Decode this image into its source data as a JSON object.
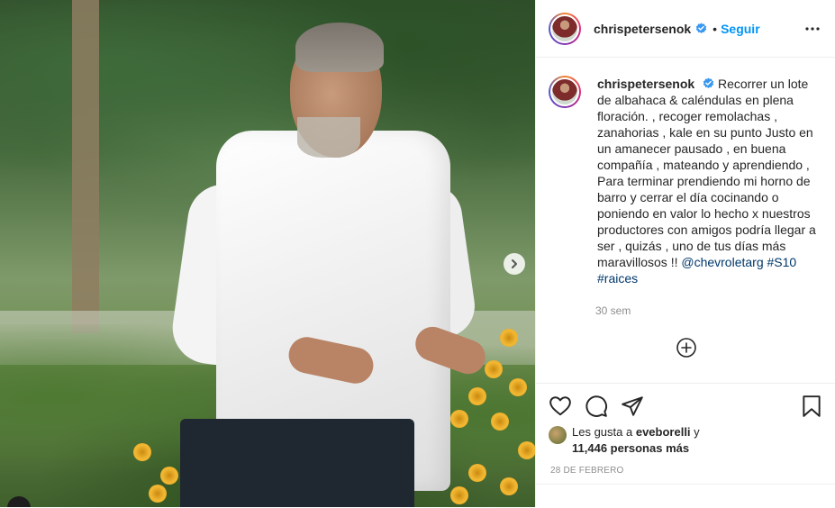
{
  "author": {
    "username": "chrispetersenok",
    "verified": true,
    "follow_label": "Seguir"
  },
  "caption": {
    "text": "Recorrer un lote de albahaca & caléndulas en plena floración. , recoger remolachas , zanahorias , kale en su punto Justo en un amanecer pausado , en buena compañía , mateando y aprendiendo , Para terminar prendiendo mi horno de barro y cerrar el día cocinando o poniendo en valor lo hecho x nuestros productores con amigos podría llegar a ser , quizás , uno de tus días más maravillosos !!",
    "mention": "@chevroletarg",
    "hashtag1": "#S10",
    "hashtag2": "#raices",
    "time_ago": "30 sem"
  },
  "likes": {
    "prefix": "Les gusta a",
    "user": "eveborelli",
    "conj": "y",
    "count": "11,446 personas más"
  },
  "date": "28 DE FEBRERO",
  "icons": {
    "more": "more-options-icon",
    "verified": "verified-badge-icon",
    "next": "chevron-right-icon",
    "add": "add-comment-icon",
    "like": "heart-icon",
    "comment": "comment-icon",
    "share": "share-icon",
    "save": "bookmark-icon"
  },
  "colors": {
    "accent": "#0095f6",
    "link": "#00376b",
    "muted": "#8e8e8e"
  }
}
